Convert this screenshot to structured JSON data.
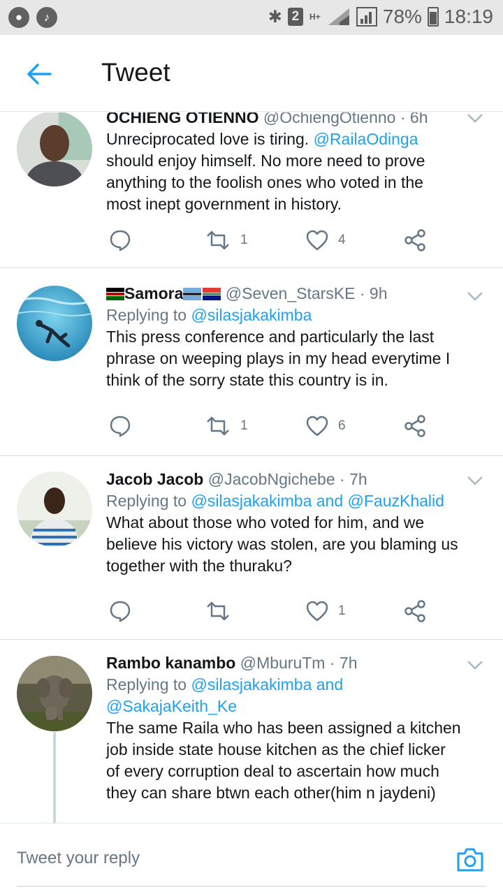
{
  "statusbar": {
    "left_icons": [
      "music-app-icon",
      "music-note-icon"
    ],
    "sim_badge": "2",
    "network": "H+",
    "battery": "78%",
    "time": "18:19"
  },
  "header": {
    "title": "Tweet"
  },
  "tweets": [
    {
      "name": "OCHIENG OTIENNO",
      "handle": "@OchiengOtienno",
      "time": "· 6h",
      "text_lines": [
        "Unreciprocated love is tiring.",
        "should enjoy himself. No more need to prove",
        "anything to the foolish ones who voted in the",
        "most inept government in history."
      ],
      "mention": "@RailaOdinga",
      "retweets": "1",
      "likes": "4"
    },
    {
      "name": "Samora",
      "handle": "@Seven_StarsKE",
      "time": "· 9h",
      "replying_label": "Replying to",
      "replying_to": "@silasjakakimba",
      "text_lines": [
        "This press conference and particularly the last",
        "phrase on weeping plays in my head everytime I",
        "think of the sorry state this country is in."
      ],
      "retweets": "1",
      "likes": "6"
    },
    {
      "name": "Jacob Jacob",
      "handle": "@JacobNgichebe",
      "time": "· 7h",
      "replying_label": "Replying to",
      "replying_to": "@silasjakakimba and @FauzKhalid",
      "text_lines": [
        "What about those who voted for him, and we",
        "believe his victory was stolen, are you blaming us",
        "together with the thuraku?"
      ],
      "retweets": "",
      "likes": "1"
    },
    {
      "name": "Rambo kanambo",
      "handle": "@MburuTm",
      "time": "· 7h",
      "replying_label": "Replying to",
      "replying_to": "@silasjakakimba and",
      "replying_to_2": "@SakajaKeith_Ke",
      "text_lines": [
        "The same Raila who has been assigned a kitchen",
        "job inside state house kitchen as the chief licker",
        "of every corruption deal to ascertain how much",
        "they can share btwn each other(him n jaydeni)"
      ]
    }
  ],
  "reply": {
    "placeholder": "Tweet your reply"
  },
  "colors": {
    "accent": "#1da1f2",
    "muted": "#657786",
    "text": "#14171a"
  }
}
